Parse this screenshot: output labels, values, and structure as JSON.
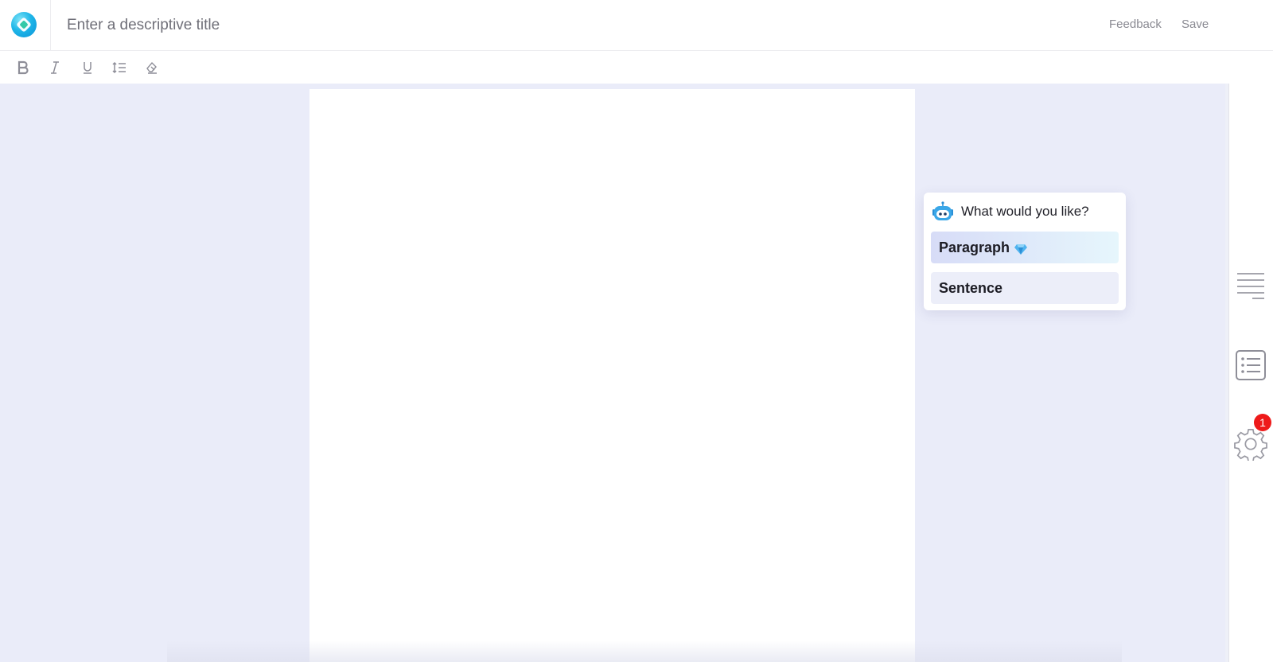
{
  "header": {
    "title_placeholder": "Enter a descriptive title",
    "feedback_label": "Feedback",
    "save_label": "Save"
  },
  "toolbar": {
    "buttons": [
      {
        "name": "bold",
        "icon": "bold-icon"
      },
      {
        "name": "italic",
        "icon": "italic-icon"
      },
      {
        "name": "underline",
        "icon": "underline-icon"
      },
      {
        "name": "line-spacing",
        "icon": "line-spacing-icon"
      },
      {
        "name": "clear-format",
        "icon": "eraser-icon"
      }
    ]
  },
  "popup": {
    "title": "What would you like?",
    "options": [
      {
        "label": "Paragraph",
        "premium": true
      },
      {
        "label": "Sentence",
        "premium": false
      }
    ]
  },
  "sidebar": {
    "items": [
      {
        "icon": "text-align-icon"
      },
      {
        "icon": "list-icon"
      },
      {
        "icon": "gear-icon",
        "badge": "1"
      }
    ]
  },
  "colors": {
    "workspace_bg": "#eaecf9",
    "badge": "#ee1a1a",
    "accent": "#1fb6e8"
  }
}
